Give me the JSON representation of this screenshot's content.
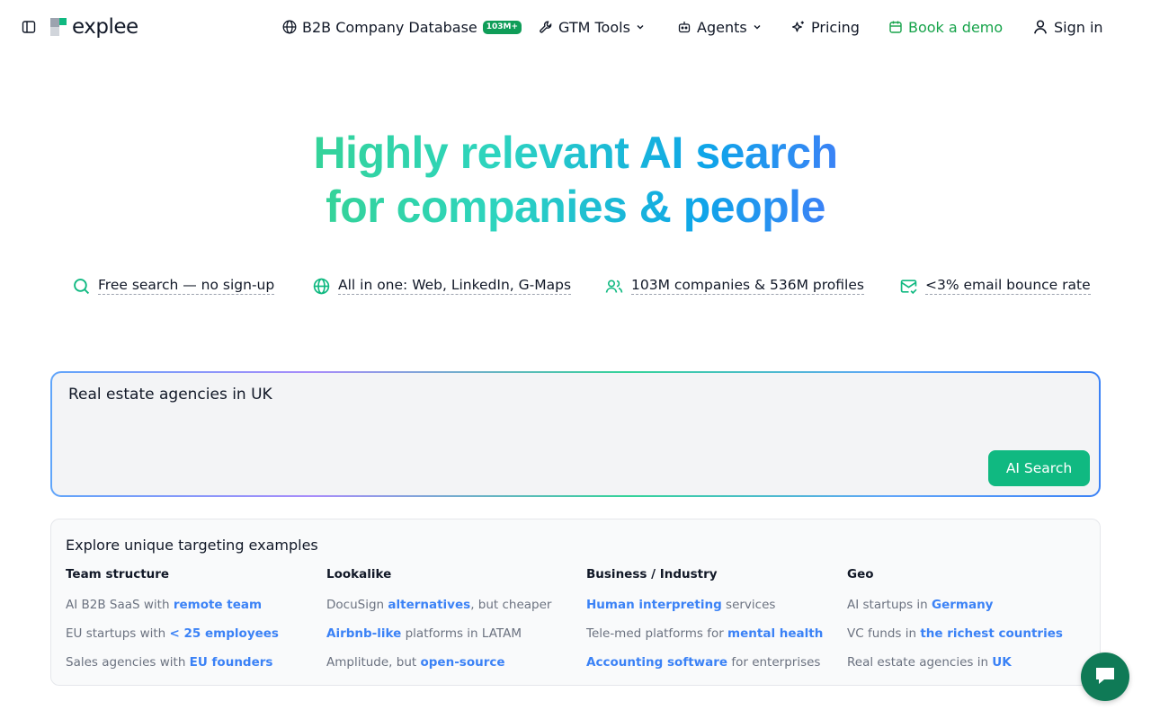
{
  "header": {
    "logo_text": "explee",
    "nav": {
      "database_label": "B2B Company Database",
      "database_badge": "103M+",
      "gtm_label": "GTM Tools",
      "agents_label": "Agents",
      "pricing_label": "Pricing",
      "demo_label": "Book a demo",
      "signin_label": "Sign in"
    }
  },
  "hero": {
    "title_line1_a": "Highly relevant ",
    "title_line1_b": "AI search",
    "title_line2": "for companies & people"
  },
  "features": [
    {
      "label": "Free search — no sign-up",
      "icon": "search-icon"
    },
    {
      "label": "All in one: Web, LinkedIn, G-Maps",
      "icon": "globe-icon"
    },
    {
      "label": "103M companies & 536M profiles",
      "icon": "users-icon"
    },
    {
      "label": "<3% email bounce rate",
      "icon": "mail-check-icon"
    }
  ],
  "search": {
    "value": "Real estate agencies in UK",
    "button_label": "AI Search"
  },
  "examples": {
    "title": "Explore unique targeting examples",
    "columns": [
      {
        "heading": "Team structure",
        "items": [
          {
            "before": "AI B2B SaaS with ",
            "highlight": "remote team",
            "after": ""
          },
          {
            "before": "EU startups with ",
            "highlight": "< 25 employees",
            "after": ""
          },
          {
            "before": "Sales agencies with ",
            "highlight": "EU founders",
            "after": ""
          }
        ]
      },
      {
        "heading": "Lookalike",
        "items": [
          {
            "before": "DocuSign ",
            "highlight": "alternatives",
            "after": ", but cheaper"
          },
          {
            "before": "",
            "highlight": "Airbnb-like",
            "after": " platforms in LATAM"
          },
          {
            "before": "Amplitude, but ",
            "highlight": "open-source",
            "after": ""
          }
        ]
      },
      {
        "heading": "Business / Industry",
        "items": [
          {
            "before": "",
            "highlight": "Human interpreting",
            "after": " services"
          },
          {
            "before": "Tele-med platforms for ",
            "highlight": "mental health",
            "after": ""
          },
          {
            "before": "",
            "highlight": "Accounting software",
            "after": " for enterprises"
          }
        ]
      },
      {
        "heading": "Geo",
        "items": [
          {
            "before": "AI startups in ",
            "highlight": "Germany",
            "after": ""
          },
          {
            "before": "VC funds in ",
            "highlight": "the richest countries",
            "after": ""
          },
          {
            "before": "Real estate agencies in ",
            "highlight": "UK",
            "after": ""
          }
        ]
      }
    ]
  },
  "colors": {
    "brand_green": "#10b981",
    "link_blue": "#3b82f6",
    "demo_green": "#16a34a",
    "chat_bg": "#0f7a56"
  }
}
